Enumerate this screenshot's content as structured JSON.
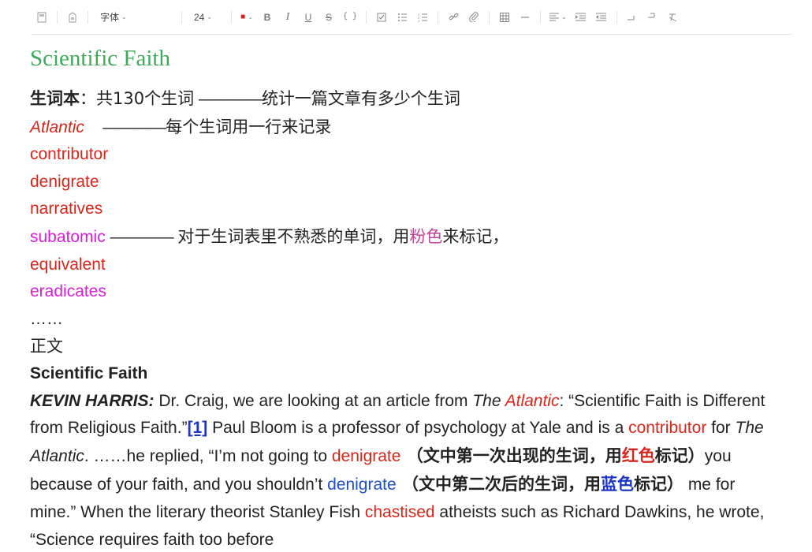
{
  "toolbar": {
    "font_label": "字体",
    "size_label": "24",
    "text_color": "#d12020"
  },
  "document": {
    "title": "Scientific Faith",
    "vocab_header": {
      "label": "生词本",
      "colon": "：",
      "count_text": "共130个生词",
      "dash": "————",
      "note": "统计一篇文章有多少个生词"
    },
    "words": [
      {
        "word": "Atlantic",
        "color": "red-italic",
        "dash": "————",
        "note": "每个生词用一行来记录"
      },
      {
        "word": "contributor",
        "color": "red"
      },
      {
        "word": "denigrate",
        "color": "red"
      },
      {
        "word": "narratives",
        "color": "red"
      },
      {
        "word": "subatomic",
        "color": "magenta",
        "dash": "————",
        "note_before": "对于生词表里不熟悉的单词，用",
        "note_highlight": "粉色",
        "note_after": "来标记，"
      },
      {
        "word": "equivalent",
        "color": "red"
      },
      {
        "word": "eradicates",
        "color": "magenta"
      }
    ],
    "ellipsis": "……",
    "body_label": "正文",
    "body_title": "Scientific Faith",
    "paragraph": {
      "speaker": "KEVIN HARRIS:",
      "t1": " Dr. Craig, we are looking at an article from ",
      "the1": "The ",
      "atlantic1": "Atlantic",
      "t2": ": “Scientific Faith is Different from Religious Faith.”",
      "ref": "[1]",
      "t3": " Paul Bloom is a professor of psychology at Yale and is a ",
      "contributor": "contributor",
      "t4": " for ",
      "atlantic2": "The Atlantic",
      "t5": ". ……he replied, “I’m not going to ",
      "denigrate1": "denigrate",
      "cn1a": " （文中第一次出现的生词，用",
      "cn1_red": "红色",
      "cn1b": "标记）",
      "t6": "you because of your faith, and you shouldn’t ",
      "denigrate2": "denigrate",
      "cn2a": " （文中第二次后的生词，用",
      "cn2_blue": "蓝色",
      "cn2b": "标记）",
      "t7": " me for mine.” When the literary theorist Stanley Fish ",
      "chastised": "chastised",
      "t8": " atheists such as Richard Dawkins, he wrote, “Science requires faith too before"
    }
  }
}
